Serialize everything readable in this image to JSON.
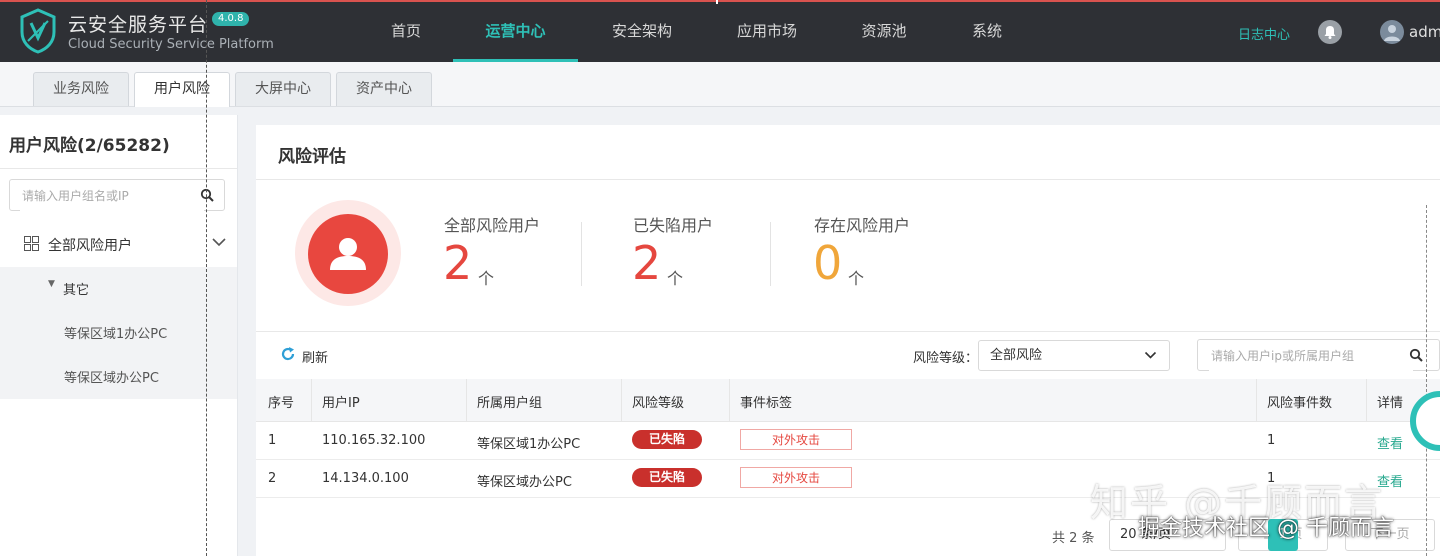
{
  "header": {
    "brand_cn": "云安全服务平台",
    "brand_en": "Cloud Security Service Platform",
    "version": "4.0.8",
    "nav": [
      {
        "label": "首页",
        "active": false
      },
      {
        "label": "运营中心",
        "active": true
      },
      {
        "label": "安全架构",
        "active": false
      },
      {
        "label": "应用市场",
        "active": false
      },
      {
        "label": "资源池",
        "active": false
      },
      {
        "label": "系统",
        "active": false
      }
    ],
    "log_link": "日志中心",
    "bell_icon": "bell-icon",
    "user": "adm"
  },
  "tabs": [
    {
      "label": "业务风险",
      "active": false
    },
    {
      "label": "用户风险",
      "active": true
    },
    {
      "label": "大屏中心",
      "active": false
    },
    {
      "label": "资产中心",
      "active": false
    }
  ],
  "sidebar": {
    "title": "用户风险(2/65282)",
    "search_placeholder": "请输入用户组名或IP",
    "tree": {
      "root_label": "全部风险用户",
      "group_label": "其它",
      "leaves": [
        "等保区域1办公PC",
        "等保区域办公PC"
      ]
    }
  },
  "main": {
    "title": "风险评估",
    "stats": [
      {
        "label": "全部风险用户",
        "value": "2",
        "unit": "个",
        "color": "#e5473f"
      },
      {
        "label": "已失陷用户",
        "value": "2",
        "unit": "个",
        "color": "#e5473f"
      },
      {
        "label": "存在风险用户",
        "value": "0",
        "unit": "个",
        "color": "#f0a63a"
      }
    ],
    "toolbar": {
      "refresh_label": "刷新",
      "level_label": "风险等级：",
      "level_value": "全部风险",
      "search_placeholder": "请输入用户ip或所属用户组"
    },
    "table": {
      "columns": [
        "序号",
        "用户IP",
        "所属用户组",
        "风险等级",
        "事件标签",
        "风险事件数",
        "详情"
      ],
      "rows": [
        {
          "index": "1",
          "ip": "110.165.32.100",
          "group": "等保区域1办公PC",
          "level": "已失陷",
          "tag": "对外攻击",
          "count": "1",
          "detail": "查看"
        },
        {
          "index": "2",
          "ip": "14.134.0.100",
          "group": "等保区域办公PC",
          "level": "已失陷",
          "tag": "对外攻击",
          "count": "1",
          "detail": "查看"
        }
      ]
    },
    "pager": {
      "total": "共 2 条",
      "page_size": "20 条/页",
      "prev": "上一页",
      "current": "1",
      "next": "下一页"
    }
  },
  "watermark": {
    "line1": "知乎 @千顾而言",
    "line2": "掘金技术社区 @ 千顾而言"
  },
  "colors": {
    "accent": "#2ec0b7",
    "danger": "#e5473f",
    "warning": "#f0a63a"
  }
}
